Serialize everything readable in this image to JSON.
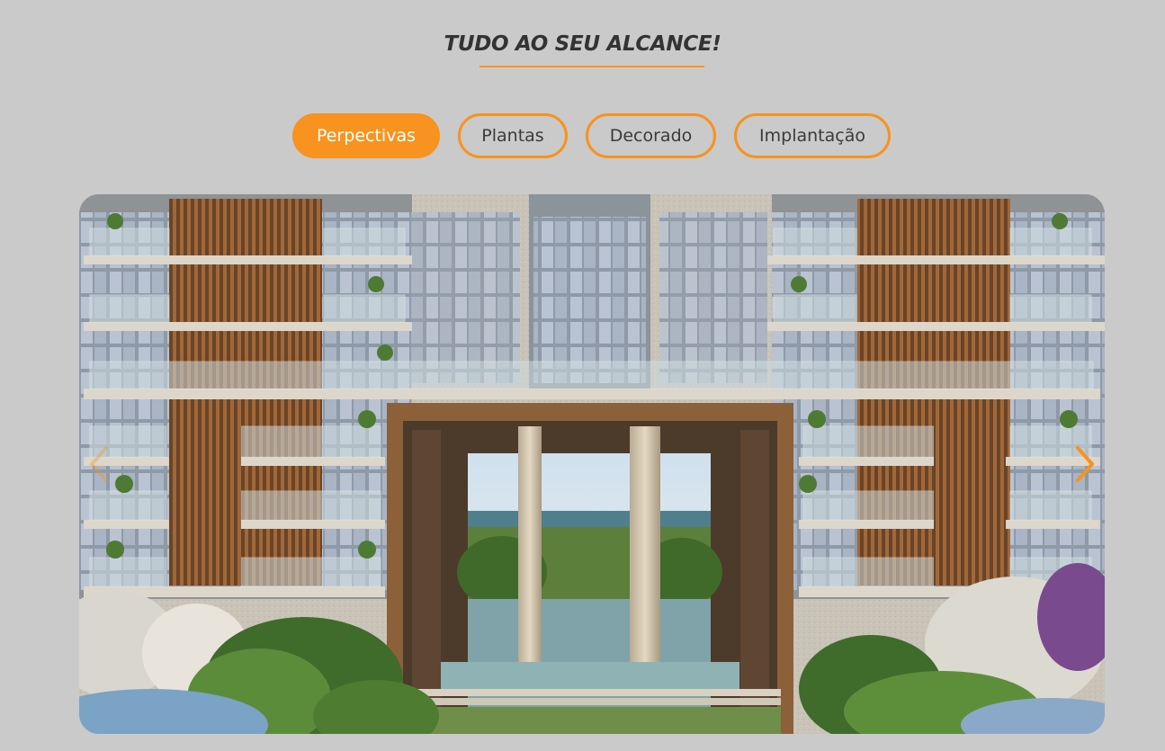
{
  "section": {
    "title": "TUDO AO SEU ALCANCE!"
  },
  "tabs": [
    {
      "label": "Perpectivas",
      "active": true
    },
    {
      "label": "Plantas",
      "active": false
    },
    {
      "label": "Decorado",
      "active": false
    },
    {
      "label": "Implantação",
      "active": false
    }
  ],
  "carousel": {
    "image_alt": "Fachada do edifício residencial com portal central e jardins",
    "prev_icon": "chevron-left-icon",
    "next_icon": "chevron-right-icon"
  },
  "colors": {
    "accent": "#f7931e",
    "background": "#cacaca",
    "heading": "#333333",
    "tab_text": "#3a3a3a"
  }
}
